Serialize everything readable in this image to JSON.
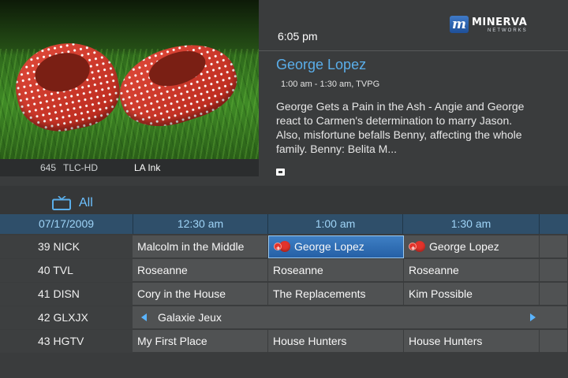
{
  "preview": {
    "channel_number": "645",
    "channel_name": "TLC-HD",
    "show": "LA Ink"
  },
  "info": {
    "clock": "6:05 pm",
    "logo_name": "MINERVA",
    "logo_sub": "NETWORKS",
    "logo_badge": "m",
    "title": "George Lopez",
    "time_rating": "1:00 am - 1:30 am, TVPG",
    "description": "George Gets a Pain in the Ash - Angie and George react to Carmen's determination to marry Jason. Also, misfortune befalls Benny, affecting the whole family. Benny: Belita M..."
  },
  "filter": {
    "label": "All",
    "icon": "tv-icon"
  },
  "grid": {
    "date": "07/17/2009",
    "times": [
      "12:30 am",
      "1:00 am",
      "1:30 am"
    ],
    "rows": [
      {
        "channel": "39 NICK",
        "programs": [
          "Malcolm in the Middle",
          "George Lopez",
          "George Lopez"
        ]
      },
      {
        "channel": "40 TVL",
        "programs": [
          "Roseanne",
          "Roseanne",
          "Roseanne"
        ]
      },
      {
        "channel": "41 DISN",
        "programs": [
          "Cory in the House",
          "The Replacements",
          "Kim Possible"
        ]
      },
      {
        "channel": "42 GLXJX",
        "programs": [
          "Galaxie Jeux"
        ]
      },
      {
        "channel": "43 HGTV",
        "programs": [
          "My First Place",
          "House Hunters",
          "House Hunters"
        ]
      }
    ]
  },
  "colors": {
    "accent": "#5aaeea",
    "selected_cell": "#2f6db4",
    "record_icon": "#e2332b"
  }
}
